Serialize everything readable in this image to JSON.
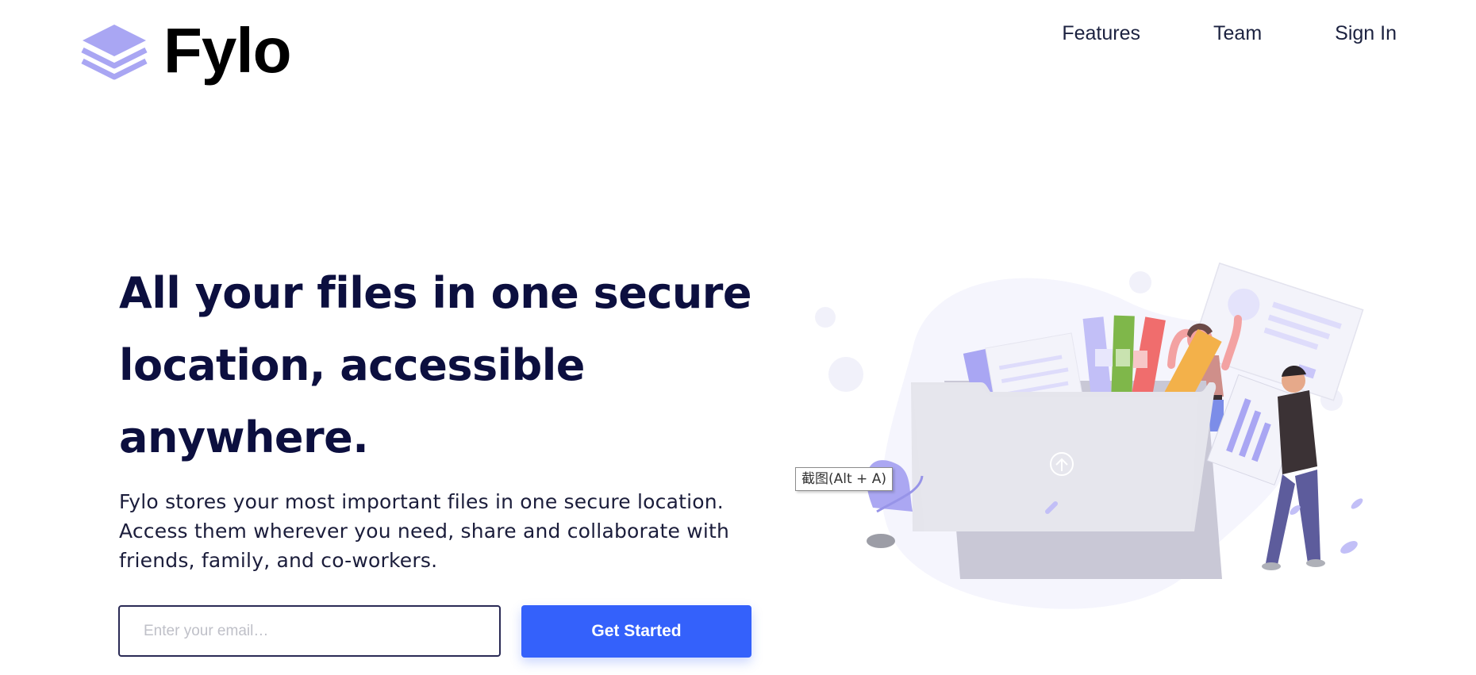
{
  "header": {
    "logo_text": "Fylo",
    "logo_icon": "stacked-layers-icon",
    "nav": [
      {
        "label": "Features"
      },
      {
        "label": "Team"
      },
      {
        "label": "Sign In"
      }
    ]
  },
  "hero": {
    "headline": "All your files in one secure location, accessible anywhere.",
    "description": "Fylo stores your most important files in one secure location. Access them wherever you need, share and collaborate with friends, family, and co-workers.",
    "email_placeholder": "Enter your email…",
    "cta_label": "Get Started"
  },
  "tooltip": {
    "text": "截图(Alt + A)"
  },
  "colors": {
    "accent_blue": "#3461fb",
    "headline_navy": "#0c0f3f",
    "logo_lavender": "#a9a6f3"
  }
}
